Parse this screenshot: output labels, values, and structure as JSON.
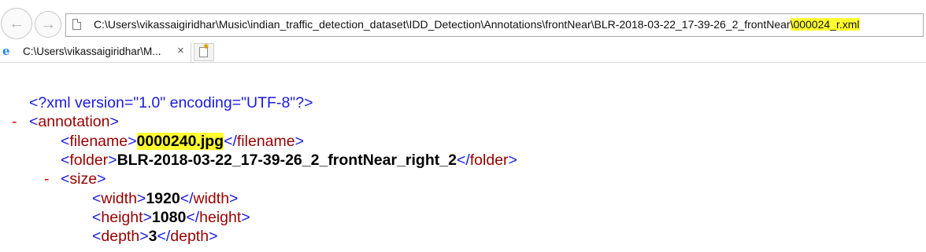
{
  "navigation": {
    "back_icon": "back-arrow-icon",
    "forward_icon": "forward-arrow-icon"
  },
  "address_bar": {
    "url_prefix": "C:\\Users\\vikassaigiridhar\\Music\\indian_traffic_detection_dataset\\IDD_Detection\\Annotations\\frontNear\\BLR-2018-03-22_17-39-26_2_frontNear",
    "url_highlighted": "\\000024_r.xml",
    "highlight_color": "#ffff30",
    "icon": "page-icon"
  },
  "tabs": {
    "active_label": "C:\\Users\\vikassaigiridhar\\M...",
    "close_glyph": "×",
    "icon": "internet-explorer-icon",
    "new_tab_icon": "new-tab-icon"
  },
  "xml": {
    "declaration": "<?xml version=\"1.0\" encoding=\"UTF-8\"?>",
    "collapse_glyph": "-",
    "annotation_tag": "annotation",
    "filename": {
      "tag": "filename",
      "value": "0000240.jpg"
    },
    "folder": {
      "tag": "folder",
      "value": "BLR-2018-03-22_17-39-26_2_frontNear_right_2"
    },
    "size_tag": "size",
    "width": {
      "tag": "width",
      "value": "1920"
    },
    "height": {
      "tag": "height",
      "value": "1080"
    },
    "depth": {
      "tag": "depth",
      "value": "3"
    },
    "colors": {
      "tag": "#1a1ae0",
      "name": "#990000",
      "minus": "#e00000"
    }
  }
}
